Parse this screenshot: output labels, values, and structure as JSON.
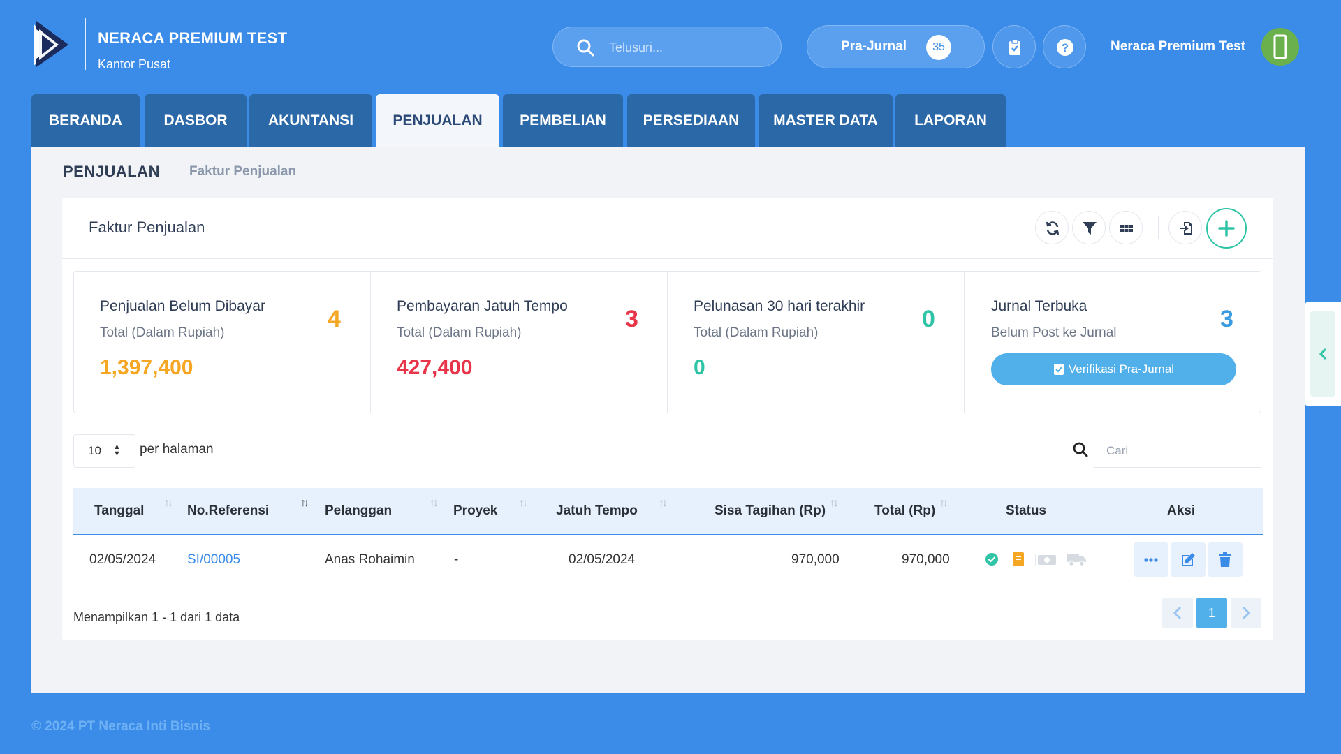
{
  "header": {
    "company": "NERACA PREMIUM TEST",
    "branch": "Kantor Pusat",
    "search_placeholder": "Telusuri...",
    "prajurnal_label": "Pra-Jurnal",
    "prajurnal_count": "35",
    "user_name": "Neraca Premium Test"
  },
  "tabs": [
    "BERANDA",
    "DASBOR",
    "AKUNTANSI",
    "PENJUALAN",
    "PEMBELIAN",
    "PERSEDIAAN",
    "MASTER DATA",
    "LAPORAN"
  ],
  "active_tab": "PENJUALAN",
  "breadcrumb": {
    "section": "PENJUALAN",
    "page": "Faktur Penjualan"
  },
  "card": {
    "title": "Faktur Penjualan"
  },
  "stats": [
    {
      "title": "Penjualan Belum Dibayar",
      "subtitle": "Total (Dalam Rupiah)",
      "count": "4",
      "value": "1,397,400",
      "color": "#f5a623"
    },
    {
      "title": "Pembayaran Jatuh Tempo",
      "subtitle": "Total (Dalam Rupiah)",
      "count": "3",
      "value": "427,400",
      "color": "#e8354a"
    },
    {
      "title": "Pelunasan 30 hari terakhir",
      "subtitle": "Total (Dalam Rupiah)",
      "count": "0",
      "value": "0",
      "color": "#2ec4a5"
    },
    {
      "title": "Jurnal Terbuka",
      "subtitle": "Belum Post ke Jurnal",
      "count": "3",
      "button": "Verifikasi Pra-Jurnal",
      "color": "#3b9be0"
    }
  ],
  "table": {
    "per_page": "10",
    "per_page_label": "per halaman",
    "search_placeholder": "Cari",
    "columns": [
      "Tanggal",
      "No.Referensi",
      "Pelanggan",
      "Proyek",
      "Jatuh Tempo",
      "Sisa Tagihan (Rp)",
      "Total (Rp)",
      "Status",
      "Aksi"
    ],
    "rows": [
      {
        "tanggal": "02/05/2024",
        "ref": "SI/00005",
        "pelanggan": "Anas Rohaimin",
        "proyek": "-",
        "jatuh_tempo": "02/05/2024",
        "sisa": "970,000",
        "total": "970,000"
      }
    ],
    "showing": "Menampilkan 1 - 1 dari 1 data",
    "current_page": "1"
  },
  "footer": "© 2024 PT Neraca Inti Bisnis"
}
